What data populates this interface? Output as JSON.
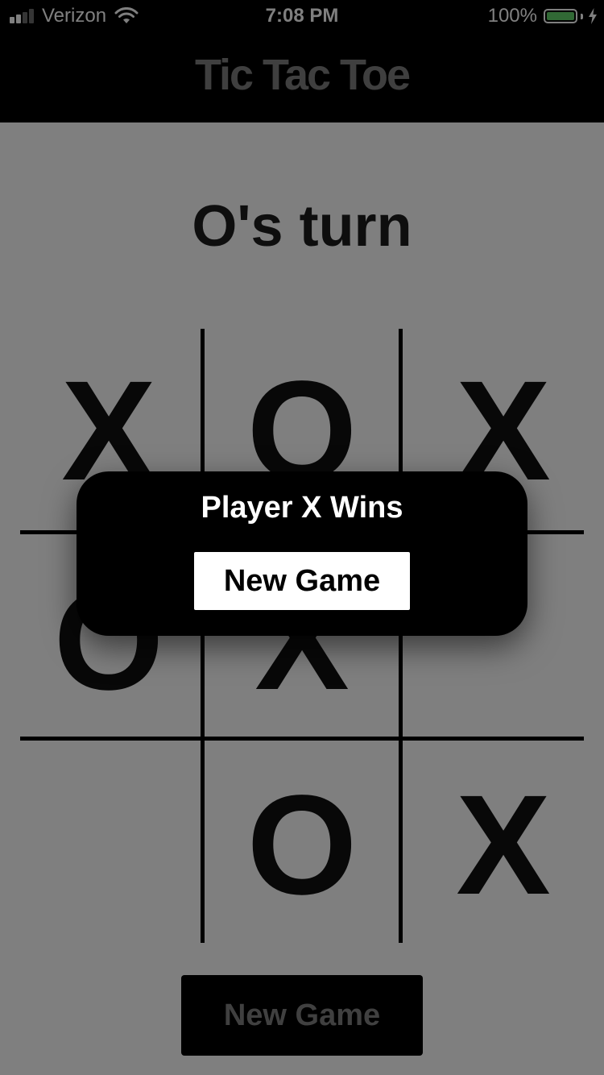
{
  "status_bar": {
    "carrier": "Verizon",
    "time": "7:08 PM",
    "battery_percent": "100%",
    "battery_level": 1.0,
    "signal_bars_filled": 2,
    "signal_bars_total": 4,
    "battery_color": "#62d36b"
  },
  "nav": {
    "title": "Tic Tac Toe"
  },
  "game": {
    "turn_label": "O's turn",
    "board": [
      [
        "X",
        "O",
        "X"
      ],
      [
        "O",
        "X",
        ""
      ],
      [
        "",
        "O",
        "X"
      ]
    ],
    "new_game_label": "New Game"
  },
  "alert": {
    "title": "Player X Wins",
    "button_label": "New Game"
  },
  "colors": {
    "overlay": "rgba(0,0,0,0.5)",
    "bar_background": "#000000",
    "title_color": "#7f7f7f"
  }
}
